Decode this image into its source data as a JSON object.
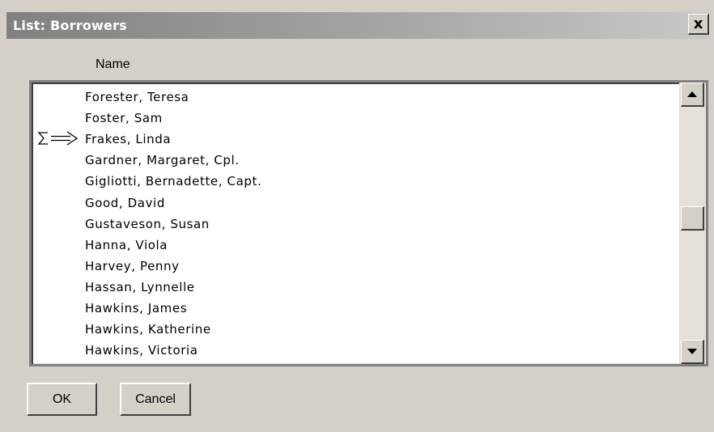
{
  "window": {
    "title": "List: Borrowers",
    "close_label": "x"
  },
  "list": {
    "column_header": "Name",
    "rows": [
      {
        "label": "Forester, Teresa"
      },
      {
        "label": "Foster, Sam"
      },
      {
        "label": "Frakes, Linda",
        "current": true
      },
      {
        "label": "Gardner, Margaret, Cpl."
      },
      {
        "label": "Gigliotti, Bernadette, Capt."
      },
      {
        "label": "Good, David"
      },
      {
        "label": "Gustaveson, Susan"
      },
      {
        "label": "Hanna, Viola"
      },
      {
        "label": "Harvey, Penny"
      },
      {
        "label": "Hassan, Lynnelle"
      },
      {
        "label": "Hawkins, James"
      },
      {
        "label": "Hawkins, Katherine"
      },
      {
        "label": "Hawkins, Victoria"
      }
    ],
    "current_row_marker": "sigma-arrow-icon"
  },
  "buttons": {
    "ok_label": "OK",
    "cancel_label": "Cancel"
  },
  "colors": {
    "window_bg": "#d4d0c8",
    "titlebar": "#808080"
  }
}
